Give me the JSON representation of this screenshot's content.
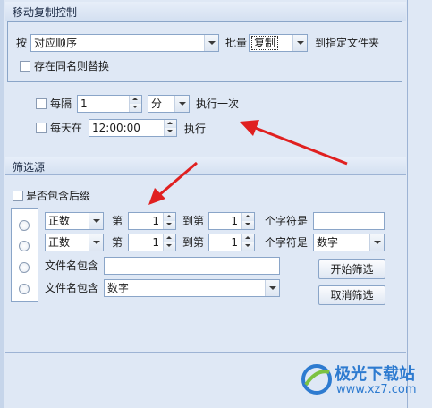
{
  "move_copy": {
    "title": "移动复制控制",
    "by_label": "按",
    "order_value": "对应顺序",
    "batch_label": "批量",
    "mode_value": "复制",
    "to_folder_label": "到指定文件夹",
    "replace_same_name": "存在同名则替换",
    "every_label": "每隔",
    "interval_value": "1",
    "unit_value": "分",
    "exec_once_label": "执行一次",
    "daily_label": "每天在",
    "time_value": "12:00:00",
    "exec_label": "执行"
  },
  "filter": {
    "title": "筛选源",
    "include_suffix": "是否包含后缀",
    "row1": {
      "type": "正数",
      "nth": "第",
      "from": "1",
      "to_label": "到第",
      "to": "1",
      "chars_label": "个字符是",
      "value": ""
    },
    "row2": {
      "type": "正数",
      "nth": "第",
      "from": "1",
      "to_label": "到第",
      "to": "1",
      "chars_label": "个字符是",
      "value": "数字"
    },
    "row3": {
      "label": "文件名包含",
      "value": ""
    },
    "row4": {
      "label": "文件名包含",
      "value": "数字"
    },
    "start_button": "开始筛选",
    "cancel_button": "取消筛选"
  },
  "watermark": {
    "brand": "极光下载站",
    "url": "www.xz7.com"
  },
  "colors": {
    "panel_bg": "#dfe8f5",
    "border": "#8aa5c8",
    "arrow": "#e02020",
    "watermark_blue": "#2e7bd0"
  }
}
